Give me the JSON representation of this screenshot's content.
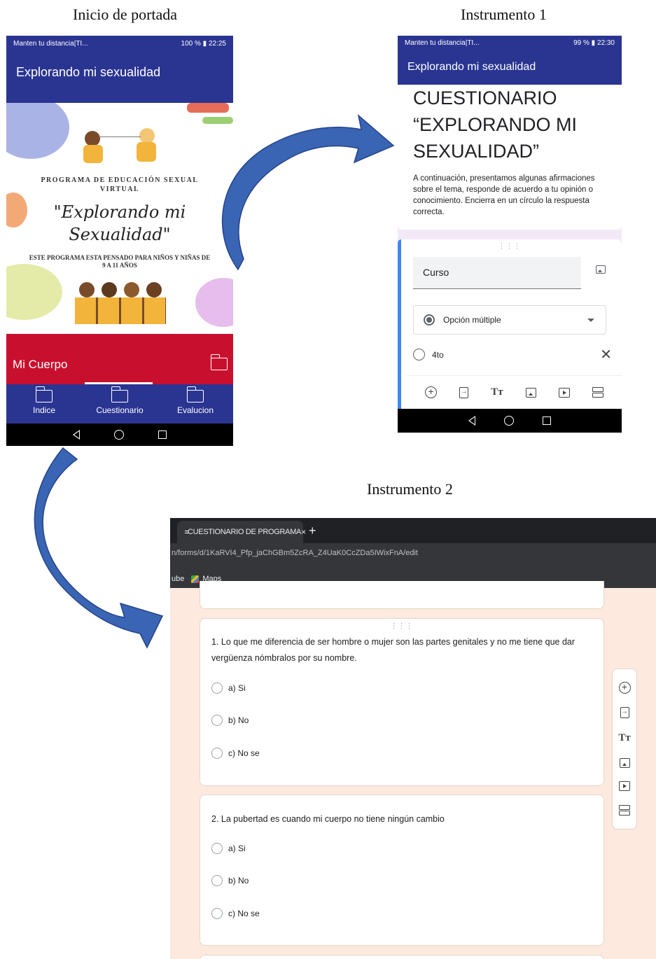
{
  "captions": {
    "left": "Inicio de portada",
    "right": "Instrumento 1",
    "bottom": "Instrumento 2"
  },
  "phone1": {
    "status": {
      "left": "Manten tu distancia|TI...",
      "right": "100 % ▮ 22:25"
    },
    "app_title": "Explorando mi sexualidad",
    "banner": {
      "kicker": "PROGRAMA DE EDUCACIÓN SEXUAL VIRTUAL",
      "title": "\"Explorando mi Sexualidad\"",
      "subtitle": "ESTE PROGRAMA ESTA PENSADO PARA NIÑOS Y NIÑAS DE 9 A 11 AÑOS"
    },
    "section_label": "Mi Cuerpo",
    "nav": [
      {
        "label": "Indice",
        "icon": "folder-icon"
      },
      {
        "label": "Cuestionario",
        "icon": "folder-icon"
      },
      {
        "label": "Evalucion",
        "icon": "folder-icon"
      }
    ],
    "colors": {
      "primary": "#2a3592",
      "accent": "#c8102e"
    }
  },
  "phone2": {
    "status": {
      "left": "Manten tu distancia|TI...",
      "right": "99 % ▮ 22:30"
    },
    "app_title": "Explorando mi sexualidad",
    "form_title": "CUESTIONARIO “EXPLORANDO MI SEXUALIDAD”",
    "form_description": "A continuación, presentamos algunas afirmaciones sobre el tema, responde de acuerdo a tu opinión o conocimiento. Encierra en un círculo la respuesta correcta.",
    "question_field": "Curso",
    "question_type": "Opción múltiple",
    "option": "4to",
    "toolbar_icons": [
      "add-question-icon",
      "import-questions-icon",
      "add-title-icon",
      "add-image-icon",
      "add-video-icon",
      "add-section-icon"
    ]
  },
  "browser": {
    "tab_title": "CUESTIONARIO DE PROGRAMA",
    "tab_close": "×",
    "new_tab": "+",
    "url": "n/forms/d/1KaRVI4_Pfp_jaChGBm5ZcRA_Z4UaK0CcZDa5IWixFnA/edit",
    "bookmarks": {
      "youtube_fragment": "ube",
      "maps": "Maps"
    },
    "questions": [
      {
        "text": "1.   Lo que me diferencia de ser hombre o mujer son las partes genitales y no me tiene que dar vergüenza nómbralos por su nombre.",
        "options": [
          "a) Si",
          "b) No",
          "c) No se"
        ]
      },
      {
        "text": "2.   La pubertad es cuando mi cuerpo no tiene ningún cambio",
        "options": [
          "a) Si",
          "b) No",
          "c) No se"
        ]
      }
    ],
    "side_toolbar_icons": [
      "add-question-icon",
      "import-questions-icon",
      "add-title-icon",
      "add-image-icon",
      "add-video-icon",
      "add-section-icon"
    ],
    "colors": {
      "background": "#fde9dd"
    }
  },
  "arrow_color": "#3a64b4"
}
